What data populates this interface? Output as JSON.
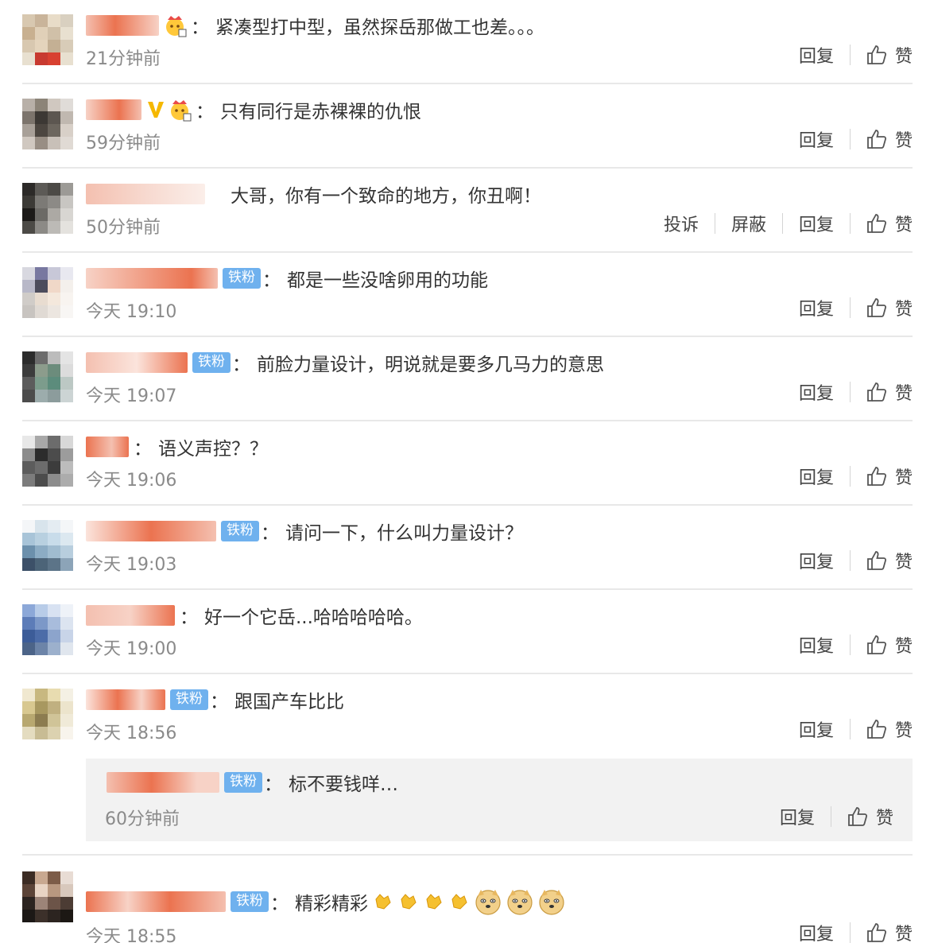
{
  "colors": {
    "accent_name": "#eb7350",
    "badge": "#6fb1ee",
    "divider": "#e8e8e8"
  },
  "actions": {
    "reply": "回复",
    "like": "赞",
    "report": "投诉",
    "block": "屏蔽"
  },
  "comments": [
    {
      "badge": "",
      "text": "紧凑型打中型，虽然探岳那做工也差。。。",
      "time": "21分钟前"
    },
    {
      "badge": "",
      "text": "只有同行是赤裸裸的仇恨",
      "time": "59分钟前"
    },
    {
      "badge": "",
      "text": "大哥，你有一个致命的地方，你丑啊！",
      "time": "50分钟前"
    },
    {
      "badge": "铁粉",
      "text": "都是一些没啥卵用的功能",
      "time": "今天 19:10"
    },
    {
      "badge": "铁粉",
      "text": "前脸力量设计，明说就是要多几马力的意思",
      "time": "今天 19:07"
    },
    {
      "badge": "",
      "text": "语义声控？？",
      "time": "今天 19:06"
    },
    {
      "badge": "铁粉",
      "text": "请问一下，什么叫力量设计？",
      "time": "今天 19:03"
    },
    {
      "badge": "",
      "text": "好一个它岳...哈哈哈哈哈。",
      "time": "今天 19:00"
    },
    {
      "badge": "铁粉",
      "text": "跟国产车比比",
      "time": "今天 18:56"
    }
  ],
  "reply": {
    "badge": "铁粉",
    "text": "标不要钱咩…",
    "time": "60分钟前"
  },
  "last": {
    "badge": "铁粉",
    "text": "精彩精彩",
    "time": "今天 18:55"
  }
}
